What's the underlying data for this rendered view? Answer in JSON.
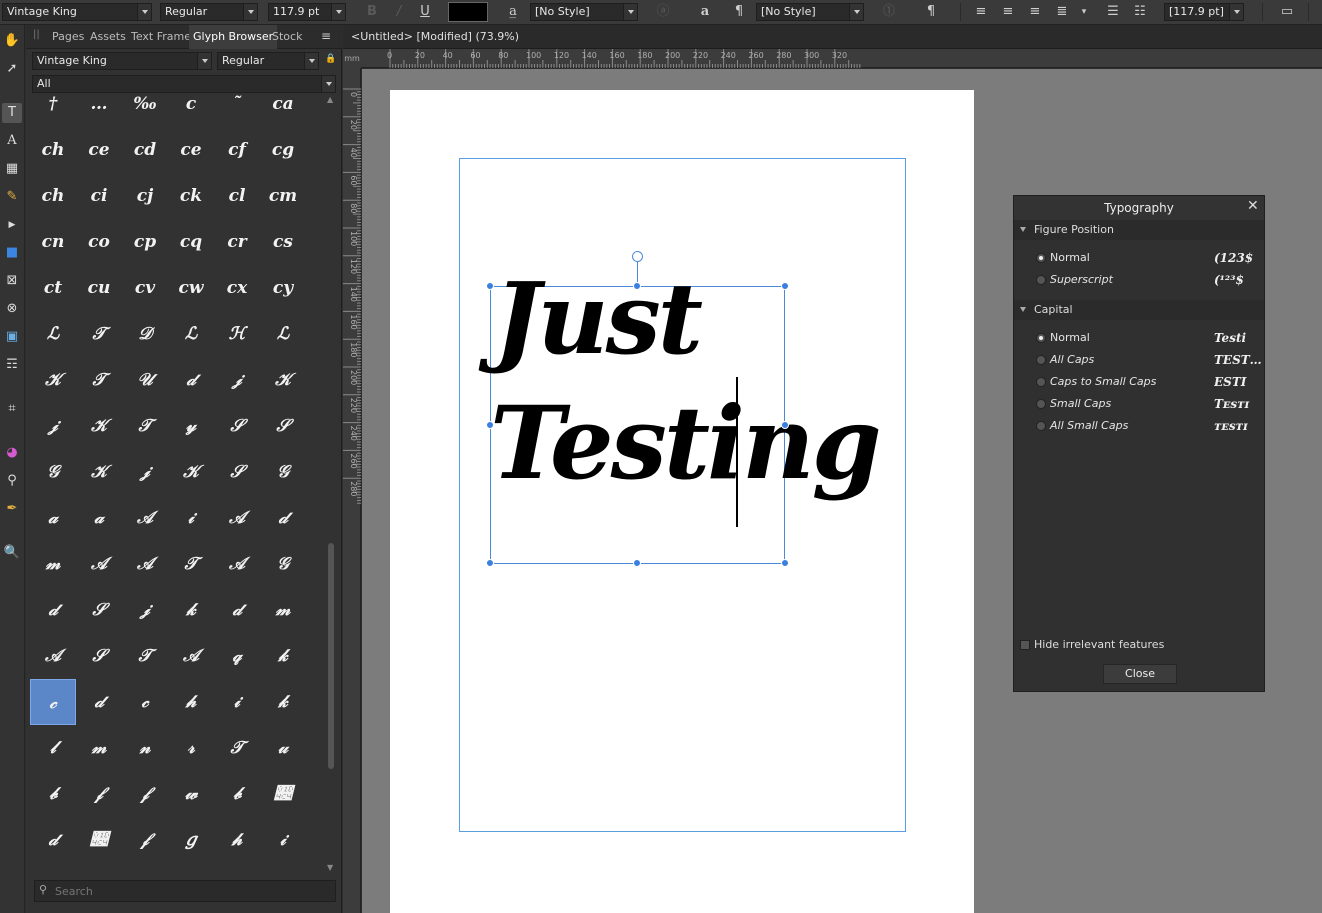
{
  "context_toolbar": {
    "font_family": "Vintage King",
    "font_style": "Regular",
    "font_size": "117.9 pt",
    "bold": "B",
    "italic": "/",
    "underline": "U",
    "char_style": "[No Style]",
    "para_style": "[No Style]",
    "char_glyph": "a",
    "para_glyph": "¶",
    "leading": "[117.9 pt]",
    "fill_color": "#000000"
  },
  "glyph_panel": {
    "tabs": [
      "Pages",
      "Assets",
      "Text Frame",
      "Glyph Browser",
      "Stock"
    ],
    "active_tab": "Glyph Browser",
    "font_family": "Vintage King",
    "font_style": "Regular",
    "subset": "All",
    "search_placeholder": "Search",
    "glyphs": [
      "†",
      "…",
      "‰",
      "c",
      "˜",
      "ca",
      "ch",
      "ce",
      "cd",
      "ce",
      "cf",
      "cg",
      "ch",
      "ci",
      "cj",
      "ck",
      "cl",
      "cm",
      "cn",
      "co",
      "cp",
      "cq",
      "cr",
      "cs",
      "ct",
      "cu",
      "cv",
      "cw",
      "cx",
      "cy",
      "ℒ",
      "𝒯",
      "𝒟",
      "ℒ",
      "ℋ",
      "ℒ",
      "𝒦",
      "𝒯",
      "𝒰",
      "𝒹",
      "𝒿",
      "𝒦",
      "𝒿",
      "𝒦",
      "𝒯",
      "𝓎",
      "𝒮",
      "𝒮",
      "𝒢",
      "𝒦",
      "𝒿",
      "𝒦",
      "𝒮",
      "𝒢",
      "𝒶",
      "𝒶",
      "𝒜",
      "𝒾",
      "𝒜",
      "𝒹",
      "𝓂",
      "𝒜",
      "𝒜",
      "𝒯",
      "𝒜",
      "𝒢",
      "𝒹",
      "𝒮",
      "𝒿",
      "𝓀",
      "𝒹",
      "𝓂",
      "𝒜",
      "𝒮",
      "𝒯",
      "𝒜",
      "𝓆",
      "𝓀",
      "𝒸",
      "𝒹",
      "𝒸",
      "𝒽",
      "𝒾",
      "𝓀",
      "𝓁",
      "𝓂",
      "𝓃",
      "𝓇",
      "𝒯",
      "𝓊",
      "𝒷",
      "𝒻",
      "𝒻",
      "𝓌",
      "𝒷",
      "𝓄",
      "𝒹",
      "𝓄",
      "𝒻",
      "𝑔",
      "𝒽",
      "𝒾"
    ]
  },
  "document": {
    "tab_title": "<Untitled> [Modified] (73.9%)",
    "ruler_unit": "mm",
    "ruler_top": [
      "0",
      "20",
      "40",
      "60",
      "80",
      "100",
      "120",
      "140",
      "160",
      "180",
      "200",
      "220",
      "240",
      "260",
      "280",
      "300",
      "320"
    ],
    "ruler_left": [
      "0",
      "20",
      "40",
      "60",
      "80",
      "100",
      "120",
      "140",
      "160",
      "180",
      "200",
      "220",
      "240",
      "260",
      "280"
    ],
    "text_line1": "Just",
    "text_line2": "Testing"
  },
  "typography_panel": {
    "title": "Typography",
    "sections": [
      {
        "title": "Figure Position",
        "options": [
          {
            "label": "Normal",
            "preview": "(123$",
            "selected": true
          },
          {
            "label": "Superscript",
            "preview": "(¹²³$",
            "selected": false
          }
        ]
      },
      {
        "title": "Capital",
        "options": [
          {
            "label": "Normal",
            "preview": "Testi",
            "selected": true
          },
          {
            "label": "All Caps",
            "preview": "TEST…",
            "selected": false
          },
          {
            "label": "Caps to Small Caps",
            "preview": "ESTI",
            "selected": false
          },
          {
            "label": "Small Caps",
            "preview": "Tᴇsᴛɪ",
            "selected": false
          },
          {
            "label": "All Small Caps",
            "preview": "ᴛᴇsᴛɪ",
            "selected": false
          }
        ]
      }
    ],
    "hide_label": "Hide irrelevant features",
    "close_label": "Close"
  }
}
